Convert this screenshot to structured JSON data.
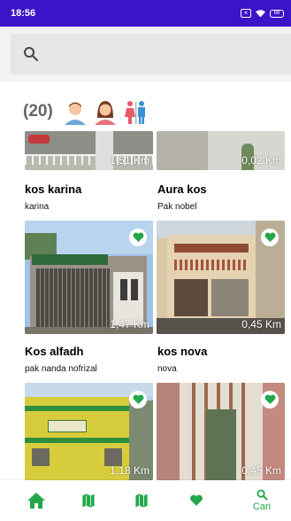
{
  "status_bar": {
    "time": "18:56",
    "battery": "68"
  },
  "search": {
    "placeholder": ""
  },
  "summary": {
    "count": "(20)"
  },
  "listings": [
    {
      "name": "kos karina",
      "owner": "karina",
      "distance": "1,51 Km"
    },
    {
      "name": "Aura kos",
      "owner": "Pak nobel",
      "distance": "0,02 Km"
    },
    {
      "name": "Kos alfadh",
      "owner": "pak nanda nofrizal",
      "distance": "1,47 Km"
    },
    {
      "name": "kos nova",
      "owner": "nova",
      "distance": "0,45 Km"
    },
    {
      "name": "",
      "owner": "",
      "distance": "1,18 Km"
    },
    {
      "name": "",
      "owner": "",
      "distance": "0,45 Km"
    }
  ],
  "bottom_nav": [
    {
      "icon": "home-icon"
    },
    {
      "icon": "map-icon"
    },
    {
      "icon": "map-icon"
    },
    {
      "icon": "heart-icon"
    },
    {
      "icon": "search-icon",
      "label": "Cari"
    }
  ],
  "colors": {
    "status_bar": "#3d13c9",
    "accent": "#22a84a"
  }
}
